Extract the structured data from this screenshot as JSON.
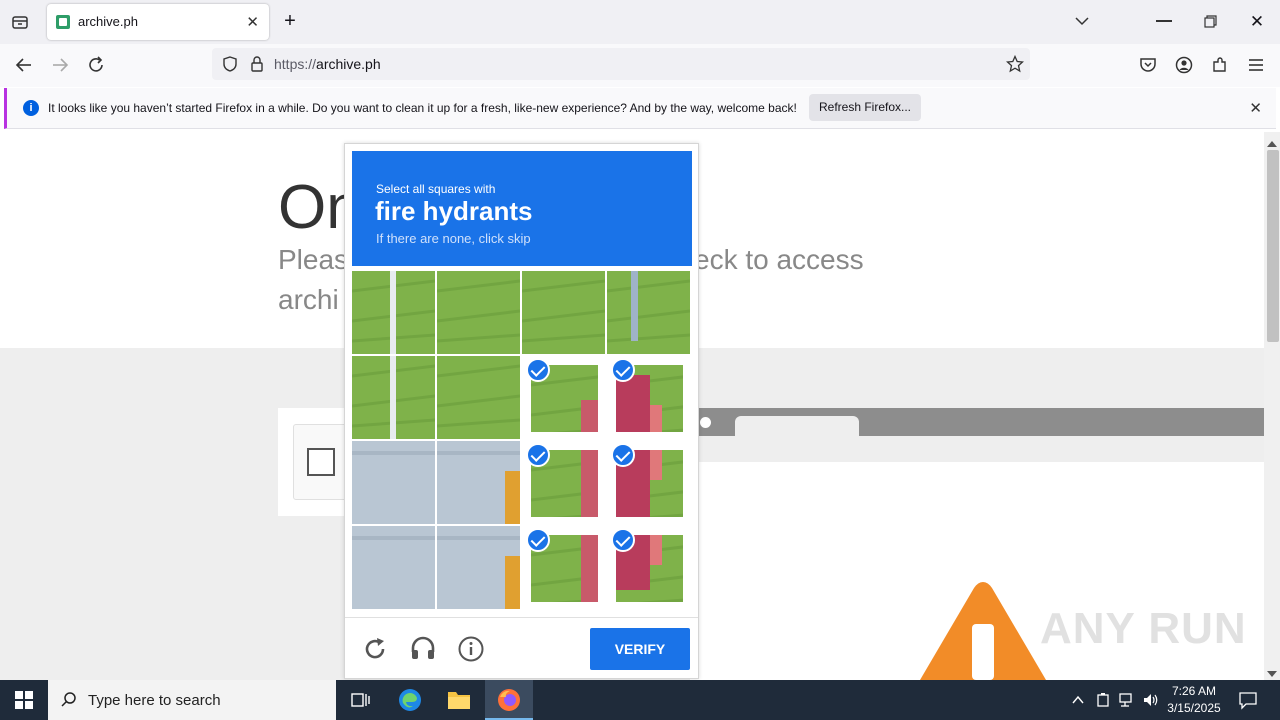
{
  "browser": {
    "tab_title": "archive.ph",
    "url_scheme": "https://",
    "url_host": "archive.ph",
    "notification": "It looks like you haven’t started Firefox in a while. Do you want to clean it up for a fresh, like-new experience? And by the way, welcome back!",
    "notification_button": "Refresh Firefox..."
  },
  "page": {
    "heading": "On",
    "subtitle_start": "Pleas",
    "subtitle_line2": "archi",
    "subtitle_end": "eck to access"
  },
  "captcha": {
    "instruction": "Select all squares with",
    "target": "fire hydrants",
    "hint": "If there are none, click skip",
    "verify_label": "VERIFY",
    "selected_tiles": [
      6,
      7,
      10,
      11,
      14,
      15
    ]
  },
  "taskbar": {
    "search_placeholder": "Type here to search",
    "time": "7:26 AM",
    "date": "3/15/2025"
  },
  "watermark": "ANY RUN"
}
